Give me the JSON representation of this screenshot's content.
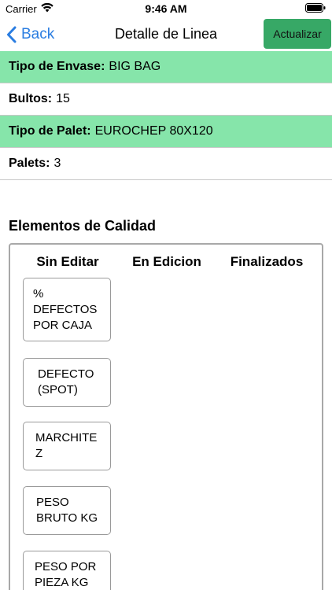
{
  "status_bar": {
    "carrier": "Carrier",
    "time": "9:46 AM"
  },
  "nav": {
    "back_label": "Back",
    "title": "Detalle de Linea",
    "update_label": "Actualizar"
  },
  "details": [
    {
      "label": "Tipo de Envase:",
      "value": "BIG BAG"
    },
    {
      "label": "Bultos:",
      "value": "15"
    },
    {
      "label": "Tipo de Palet:",
      "value": "EUROCHEP 80X120"
    },
    {
      "label": "Palets:",
      "value": "3"
    }
  ],
  "quality": {
    "section_title": "Elementos de Calidad",
    "columns": [
      "Sin Editar",
      "En Edicion",
      "Finalizados"
    ],
    "items": [
      "%\nDEFECTOS\nPOR CAJA",
      "DEFECTO\n(SPOT)",
      "MARCHITE\nZ",
      "PESO\nBRUTO KG",
      "PESO POR\nPIEZA KG"
    ]
  },
  "colors": {
    "accent": "#2a7de1",
    "row_highlight": "#86e5aa",
    "update_button": "#37a866"
  }
}
